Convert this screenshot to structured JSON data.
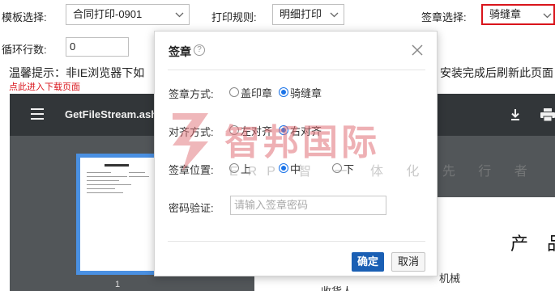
{
  "toolbar": {
    "template_label": "模板选择:",
    "template_value": "合同打印-0901",
    "print_rule_label": "打印规则:",
    "print_rule_value": "明细打印",
    "seal_select_label": "签章选择:",
    "seal_select_value": "骑缝章",
    "loop_rows_label": "循环行数:",
    "loop_rows_value": "0"
  },
  "notice": {
    "text_left": "温馨提示：非IE浏览器下如",
    "text_right": "安装完成后刷新此页面",
    "download_link": "点此进入下载页面"
  },
  "viewer": {
    "file_title": "GetFileStream.ash",
    "page_heading": "产 品",
    "body_line1": "机械",
    "body_line2": "收货人",
    "thumbnail_number": "1"
  },
  "modal": {
    "title": "签章",
    "seal_method_label": "签章方式:",
    "seal_method_options": [
      "盖印章",
      "骑缝章"
    ],
    "seal_method_selected": "骑缝章",
    "align_label": "对齐方式:",
    "align_options": [
      "左对齐",
      "右对齐"
    ],
    "align_selected": "右对齐",
    "position_label": "签章位置:",
    "position_options": [
      "上",
      "中",
      "下"
    ],
    "position_selected": "中",
    "password_label": "密码验证:",
    "password_placeholder": "请输入签章密码",
    "confirm_label": "确定",
    "cancel_label": "取消"
  },
  "watermark": {
    "big_text": "智邦国际",
    "small_text": "ERP 智 一 体 化 先 行 者"
  },
  "colors": {
    "accent": "#1a5fb4",
    "radio": "#1a73e8",
    "highlight_border": "#d9141b",
    "viewer_bar": "#323639",
    "viewer_bg": "#525659"
  }
}
